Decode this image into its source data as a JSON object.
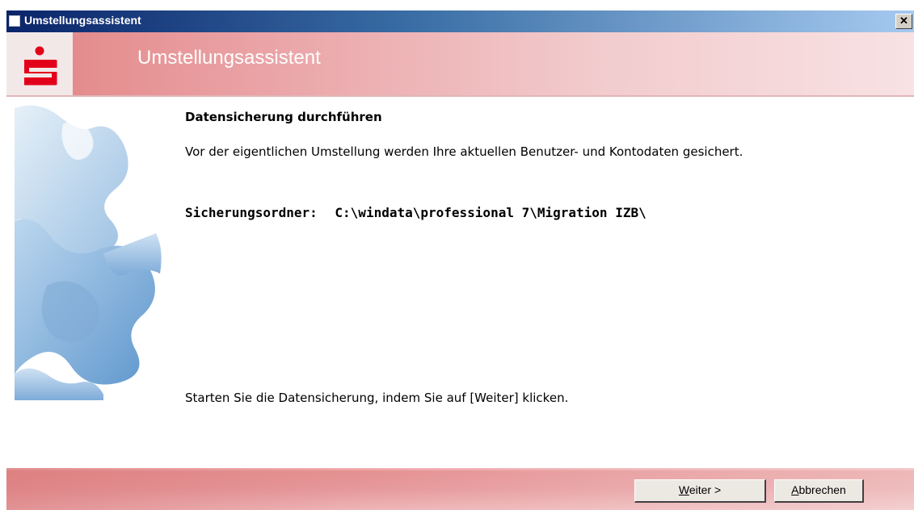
{
  "window": {
    "title": "Umstellungsassistent",
    "close_symbol": "✕"
  },
  "header": {
    "title": "Umstellungsassistent",
    "logo_icon": "sparkasse-logo-icon",
    "brand_color": "#e2001a"
  },
  "content": {
    "heading": "Datensicherung durchführen",
    "description": "Vor der eigentlichen Umstellung werden Ihre aktuellen Benutzer- und Kontodaten gesichert.",
    "folder_label": "Sicherungsordner:",
    "folder_value": "C:\\windata\\professional 7\\Migration IZB\\",
    "instruction": "Starten Sie die Datensicherung, indem Sie auf [Weiter] klicken."
  },
  "buttons": {
    "next_mnemonic": "W",
    "next_rest": "eiter >",
    "cancel_mnemonic": "A",
    "cancel_rest": "bbrechen"
  }
}
